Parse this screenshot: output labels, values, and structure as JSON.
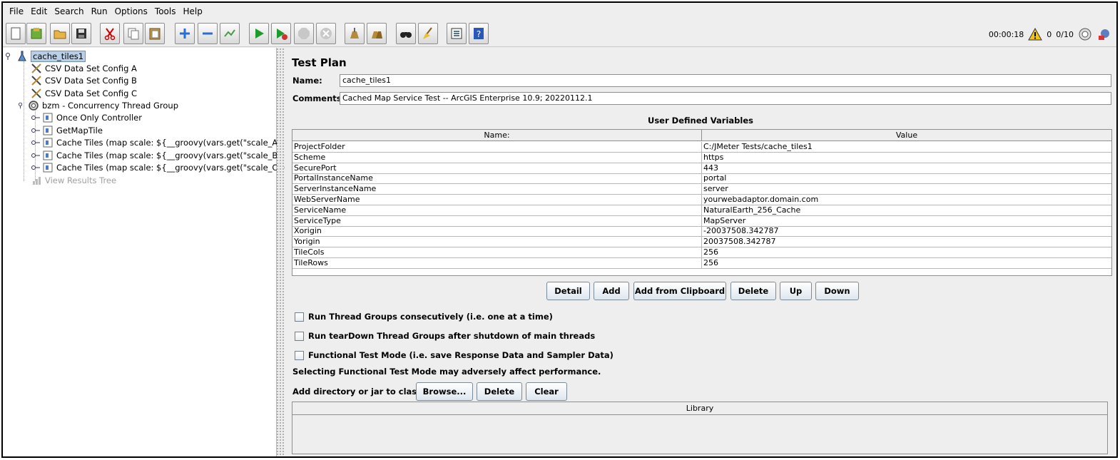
{
  "menu": [
    "File",
    "Edit",
    "Search",
    "Run",
    "Options",
    "Tools",
    "Help"
  ],
  "toolbar": {
    "buttons": [
      "new-icon",
      "templates-icon",
      "open-icon",
      "save-icon",
      "cut-icon",
      "copy-icon",
      "paste-icon",
      "expand-icon",
      "collapse-icon",
      "toggle-icon",
      "start-icon",
      "start-no-pause-icon",
      "stop-icon",
      "shutdown-icon",
      "clear-icon",
      "clear-all-icon",
      "search-icon",
      "reset-search-icon",
      "function-helper-icon",
      "help-icon"
    ],
    "timer": "00:00:18",
    "warning_count": "0",
    "threads": "0/10"
  },
  "tree": {
    "root": "cache_tiles1",
    "items": [
      "CSV Data Set Config A",
      "CSV Data Set Config B",
      "CSV Data Set Config C",
      "bzm - Concurrency Thread Group",
      "Once Only Controller",
      "GetMapTile",
      "Cache Tiles (map scale: ${__groovy(vars.get(\"scale_A\"))})",
      "Cache Tiles (map scale: ${__groovy(vars.get(\"scale_B\"))})",
      "Cache Tiles (map scale: ${__groovy(vars.get(\"scale_C\"))})",
      "View Results Tree"
    ]
  },
  "testplan": {
    "title": "Test Plan",
    "name_label": "Name:",
    "name_value": "cache_tiles1",
    "comments_label": "Comments:",
    "comments_value": "Cached Map Service Test -- ArcGIS Enterprise 10.9; 20220112.1",
    "udv_title": "User Defined Variables",
    "columns": [
      "Name:",
      "Value"
    ],
    "variables": [
      [
        "ProjectFolder",
        "C:/JMeter Tests/cache_tiles1"
      ],
      [
        "Scheme",
        "https"
      ],
      [
        "SecurePort",
        "443"
      ],
      [
        "PortalInstanceName",
        "portal"
      ],
      [
        "ServerInstanceName",
        "server"
      ],
      [
        "WebServerName",
        "yourwebadaptor.domain.com"
      ],
      [
        "ServiceName",
        "NaturalEarth_256_Cache"
      ],
      [
        "ServiceType",
        "MapServer"
      ],
      [
        "Xorigin",
        "-20037508.342787"
      ],
      [
        "Yorigin",
        "20037508.342787"
      ],
      [
        "TileCols",
        "256"
      ],
      [
        "TileRows",
        "256"
      ]
    ],
    "buttons": [
      "Detail",
      "Add",
      "Add from Clipboard",
      "Delete",
      "Up",
      "Down"
    ],
    "checkboxes": [
      "Run Thread Groups consecutively (i.e. one at a time)",
      "Run tearDown Thread Groups after shutdown of main threads",
      "Functional Test Mode (i.e. save Response Data and Sampler Data)"
    ],
    "functional_note": "Selecting Functional Test Mode may adversely affect performance.",
    "classpath_label": "Add directory or jar to classpath",
    "classpath_buttons": [
      "Browse...",
      "Delete",
      "Clear"
    ],
    "library_header": "Library"
  }
}
